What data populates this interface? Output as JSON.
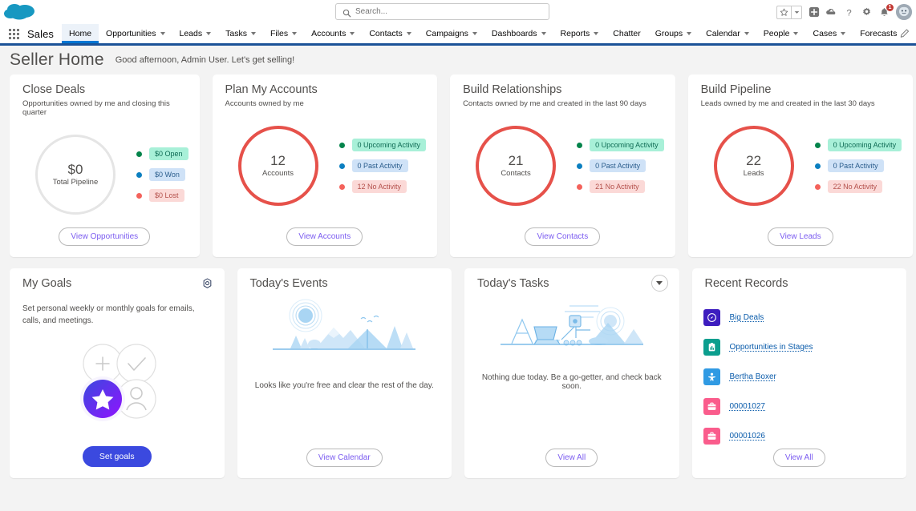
{
  "header": {
    "logo_icon": "salesforce-cloud-logo",
    "search": {
      "icon": "search-icon",
      "placeholder": "Search...",
      "value": ""
    },
    "favorites": {
      "star_icon": "star-icon",
      "caret_icon": "chevron-down-icon"
    },
    "icons": [
      {
        "name": "add-icon",
        "glyph": "plus-in-box"
      },
      {
        "name": "setup-assistant-icon",
        "glyph": "cloud-arrow"
      },
      {
        "name": "help-icon",
        "glyph": "question-mark"
      },
      {
        "name": "setup-gear-icon",
        "glyph": "gear"
      },
      {
        "name": "notifications-bell-icon",
        "glyph": "bell"
      }
    ],
    "notifications_count": "1",
    "avatar_icon": "user-avatar"
  },
  "nav": {
    "app_launcher_icon": "app-launcher-waffle-icon",
    "app_name": "Sales",
    "edit_icon": "pencil-icon",
    "items": [
      {
        "label": "Home",
        "has_caret": false,
        "active": true
      },
      {
        "label": "Opportunities",
        "has_caret": true,
        "active": false
      },
      {
        "label": "Leads",
        "has_caret": true,
        "active": false
      },
      {
        "label": "Tasks",
        "has_caret": true,
        "active": false
      },
      {
        "label": "Files",
        "has_caret": true,
        "active": false
      },
      {
        "label": "Accounts",
        "has_caret": true,
        "active": false
      },
      {
        "label": "Contacts",
        "has_caret": true,
        "active": false
      },
      {
        "label": "Campaigns",
        "has_caret": true,
        "active": false
      },
      {
        "label": "Dashboards",
        "has_caret": true,
        "active": false
      },
      {
        "label": "Reports",
        "has_caret": true,
        "active": false
      },
      {
        "label": "Chatter",
        "has_caret": false,
        "active": false
      },
      {
        "label": "Groups",
        "has_caret": true,
        "active": false
      },
      {
        "label": "Calendar",
        "has_caret": true,
        "active": false
      },
      {
        "label": "People",
        "has_caret": true,
        "active": false
      },
      {
        "label": "Cases",
        "has_caret": true,
        "active": false
      },
      {
        "label": "Forecasts",
        "has_caret": false,
        "active": false
      }
    ]
  },
  "page": {
    "title": "Seller Home",
    "greeting": "Good afternoon, Admin User. Let's get selling!"
  },
  "colors": {
    "accent_blue": "#0176d3",
    "nav_underline": "#1b5297",
    "donut_red": "#e6514a",
    "donut_gray": "#e5e5e5",
    "green_dot": "#04844b",
    "blue_dot": "#0b7fc0",
    "red_dot": "#f4625b",
    "green_pill_bg": "#a8f0d8",
    "blue_pill_bg": "#cfe2f7",
    "red_pill_bg": "#fbd9d7",
    "link_purple": "#7b5cf0",
    "link_blue": "#0b5cab",
    "goal_purple": "#7326f0",
    "set_goals_blue": "#3b49df"
  },
  "cards": {
    "close_deals": {
      "title": "Close Deals",
      "subtitle": "Opportunities owned by me and closing this quarter",
      "donut": {
        "value": "$0",
        "label": "Total Pipeline",
        "ring": "empty"
      },
      "legend": [
        {
          "dot_color": "#04844b",
          "pill_bg": "#a8f0d8",
          "pill_fg": "#0e6b54",
          "label": "$0 Open"
        },
        {
          "dot_color": "#0b7fc0",
          "pill_bg": "#cfe2f7",
          "pill_fg": "#2b5d8c",
          "label": "$0 Won"
        },
        {
          "dot_color": "#f4625b",
          "pill_bg": "#fbd9d7",
          "pill_fg": "#b4514c",
          "label": "$0 Lost"
        }
      ],
      "button": "View Opportunities"
    },
    "plan_my_accounts": {
      "title": "Plan My Accounts",
      "subtitle": "Accounts owned by me",
      "donut": {
        "value": "12",
        "label": "Accounts",
        "ring": "red"
      },
      "legend": [
        {
          "dot_color": "#04844b",
          "pill_bg": "#a8f0d8",
          "pill_fg": "#0e6b54",
          "label": "0 Upcoming Activity"
        },
        {
          "dot_color": "#0b7fc0",
          "pill_bg": "#cfe2f7",
          "pill_fg": "#2b5d8c",
          "label": "0 Past Activity"
        },
        {
          "dot_color": "#f4625b",
          "pill_bg": "#fbd9d7",
          "pill_fg": "#b4514c",
          "label": "12 No Activity"
        }
      ],
      "button": "View Accounts"
    },
    "build_relationships": {
      "title": "Build Relationships",
      "subtitle": "Contacts owned by me and created in the last 90 days",
      "donut": {
        "value": "21",
        "label": "Contacts",
        "ring": "red"
      },
      "legend": [
        {
          "dot_color": "#04844b",
          "pill_bg": "#a8f0d8",
          "pill_fg": "#0e6b54",
          "label": "0 Upcoming Activity"
        },
        {
          "dot_color": "#0b7fc0",
          "pill_bg": "#cfe2f7",
          "pill_fg": "#2b5d8c",
          "label": "0 Past Activity"
        },
        {
          "dot_color": "#f4625b",
          "pill_bg": "#fbd9d7",
          "pill_fg": "#b4514c",
          "label": "21 No Activity"
        }
      ],
      "button": "View Contacts"
    },
    "build_pipeline": {
      "title": "Build Pipeline",
      "subtitle": "Leads owned by me and created in the last 30 days",
      "donut": {
        "value": "22",
        "label": "Leads",
        "ring": "red"
      },
      "legend": [
        {
          "dot_color": "#04844b",
          "pill_bg": "#a8f0d8",
          "pill_fg": "#0e6b54",
          "label": "0 Upcoming Activity"
        },
        {
          "dot_color": "#0b7fc0",
          "pill_bg": "#cfe2f7",
          "pill_fg": "#2b5d8c",
          "label": "0 Past Activity"
        },
        {
          "dot_color": "#f4625b",
          "pill_bg": "#fbd9d7",
          "pill_fg": "#b4514c",
          "label": "22 No Activity"
        }
      ],
      "button": "View Leads"
    },
    "my_goals": {
      "title": "My Goals",
      "settings_icon": "gear-icon",
      "description": "Set personal weekly or monthly goals for emails, calls, and meetings.",
      "art_icon": "goals-badges-illustration",
      "button": "Set goals"
    },
    "todays_events": {
      "title": "Today's Events",
      "art_icon": "camping-scene-illustration",
      "empty_message": "Looks like you're free and clear the rest of the day.",
      "button": "View Calendar"
    },
    "todays_tasks": {
      "title": "Today's Tasks",
      "expand_icon": "chevron-down-icon",
      "art_icon": "beach-scene-illustration",
      "empty_message": "Nothing due today. Be a go-getter, and check back soon.",
      "button": "View All"
    },
    "recent_records": {
      "title": "Recent Records",
      "button": "View All",
      "items": [
        {
          "label": "Big Deals",
          "icon": "dashboard-icon",
          "icon_bg": "#3d1dbf"
        },
        {
          "label": "Opportunities in Stages",
          "icon": "report-icon",
          "icon_bg": "#0b9e8e"
        },
        {
          "label": "Bertha Boxer",
          "icon": "contact-icon",
          "icon_bg": "#309ae3"
        },
        {
          "label": "00001027",
          "icon": "opportunity-icon",
          "icon_bg": "#fa5c8c"
        },
        {
          "label": "00001026",
          "icon": "opportunity-icon",
          "icon_bg": "#fa5c8c"
        }
      ]
    }
  }
}
